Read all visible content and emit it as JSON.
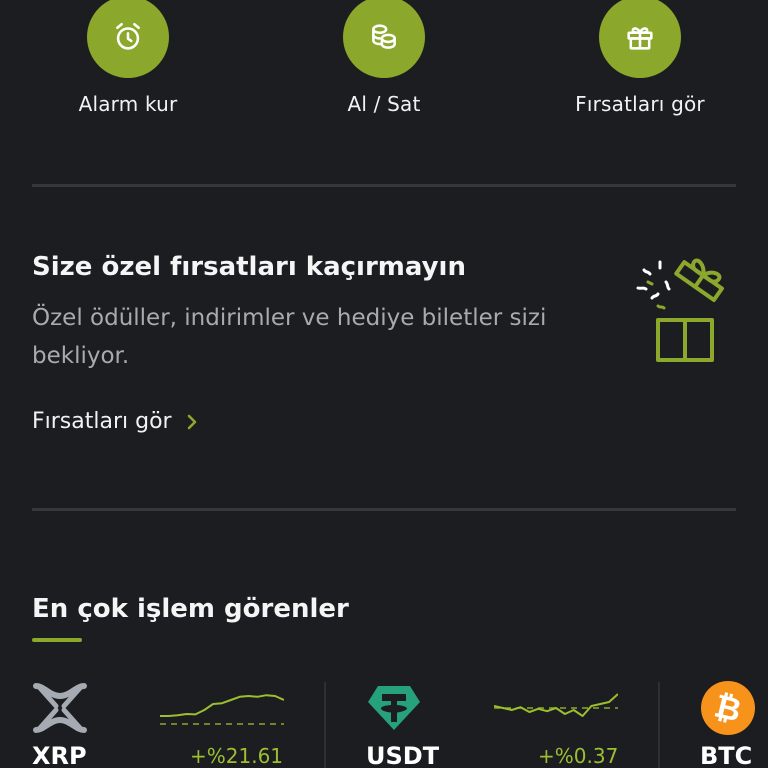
{
  "quick_actions": [
    {
      "label": "Alarm kur",
      "icon": "alarm-clock-icon"
    },
    {
      "label": "Al / Sat",
      "icon": "coins-icon"
    },
    {
      "label": "Fırsatları gör",
      "icon": "gift-icon"
    }
  ],
  "promo": {
    "title": "Size özel fırsatları kaçırmayın",
    "description": "Özel ödüller, indirimler ve hediye biletler sizi bekliyor.",
    "link_label": "Fırsatları gör",
    "illustration": "gift-box-confetti-icon"
  },
  "most_traded": {
    "title": "En çok işlem görenler",
    "coins": [
      {
        "symbol": "XRP",
        "change": "+%21.61",
        "logo": "xrp-logo-icon",
        "trend": [
          0.3,
          0.3,
          0.32,
          0.35,
          0.34,
          0.45,
          0.6,
          0.62,
          0.7,
          0.78,
          0.8,
          0.78,
          0.82,
          0.8,
          0.7
        ]
      },
      {
        "symbol": "USDT",
        "change": "+%0.37",
        "logo": "tether-logo-icon",
        "trend": [
          0.55,
          0.5,
          0.45,
          0.52,
          0.4,
          0.48,
          0.42,
          0.5,
          0.35,
          0.45,
          0.3,
          0.55,
          0.6,
          0.65,
          0.85
        ]
      },
      {
        "symbol": "BTC",
        "change": "",
        "logo": "bitcoin-logo-icon",
        "trend": []
      }
    ]
  },
  "colors": {
    "accent": "#8ba82c",
    "background": "#1c1d21",
    "positive": "#9cbf2f",
    "muted_text": "#a9aaae"
  }
}
